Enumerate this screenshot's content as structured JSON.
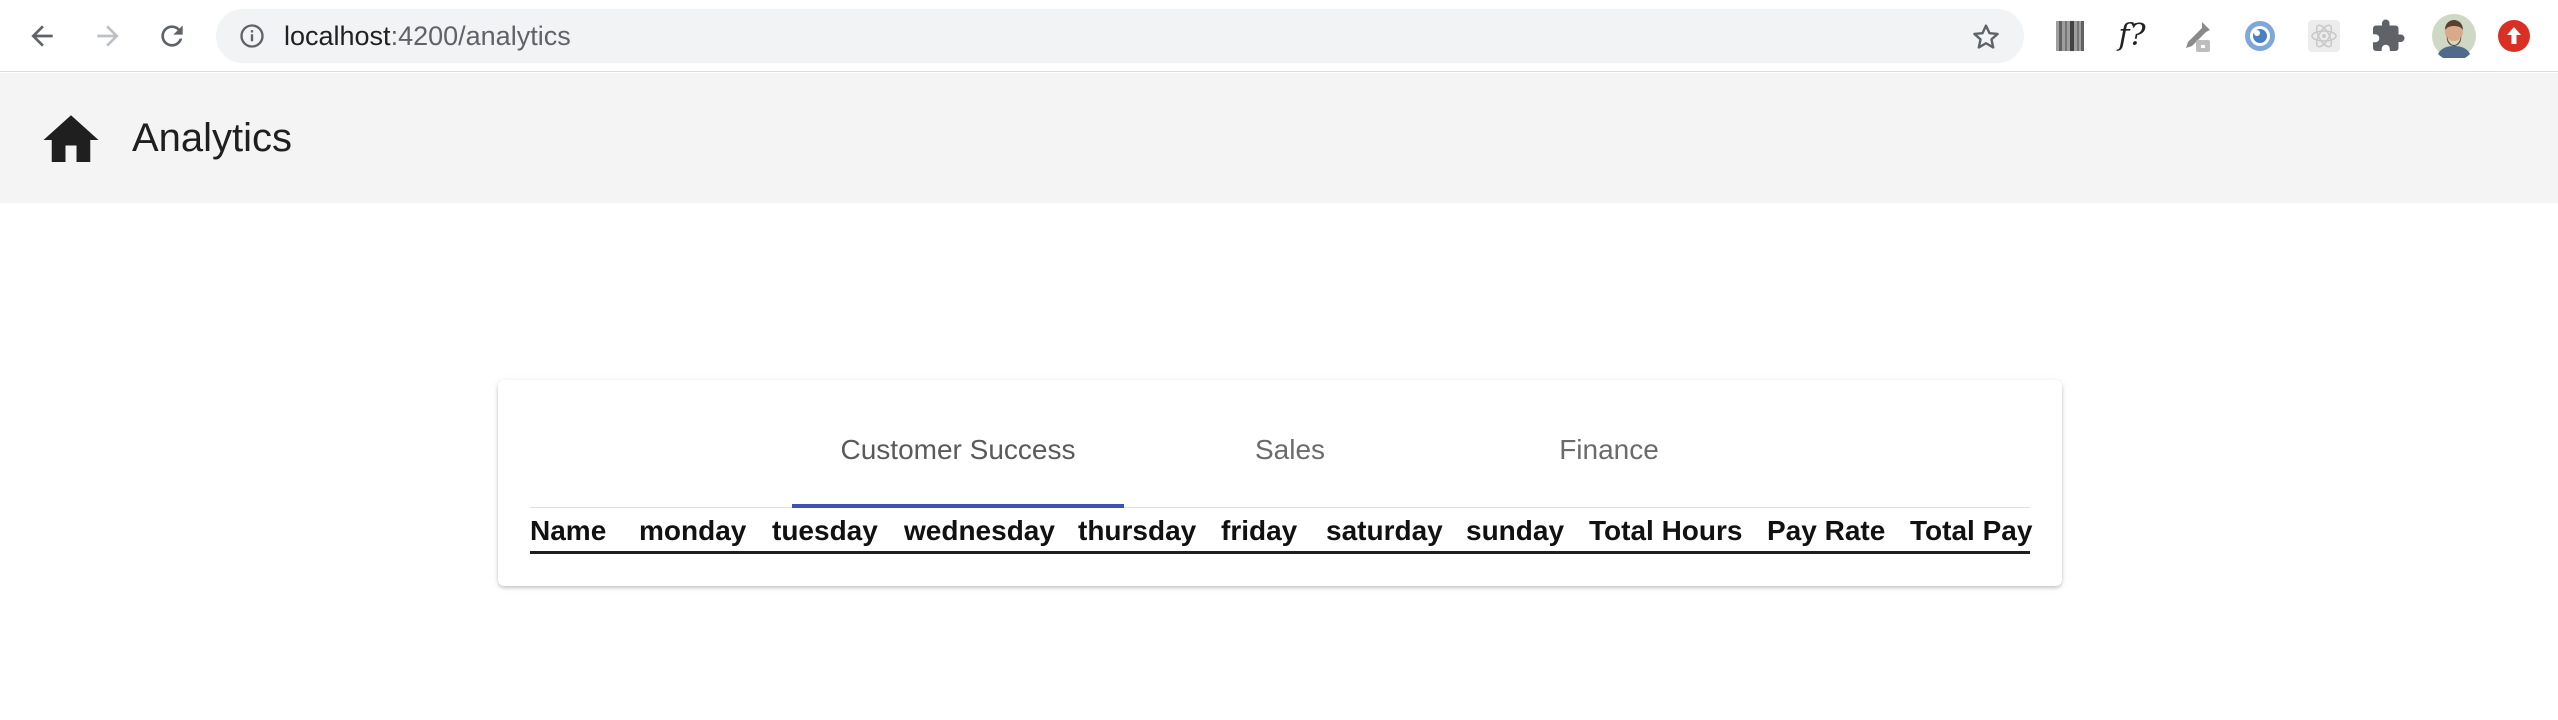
{
  "browser": {
    "url_host": "localhost",
    "url_path": ":4200/analytics",
    "fx_label": "f?"
  },
  "app": {
    "title": "Analytics"
  },
  "tabs": [
    {
      "label": "Customer Success",
      "active": true
    },
    {
      "label": "Sales",
      "active": false
    },
    {
      "label": "Finance",
      "active": false
    }
  ],
  "table": {
    "columns": [
      "Name",
      "monday",
      "tuesday",
      "wednesday",
      "thursday",
      "friday",
      "saturday",
      "sunday",
      "Total Hours",
      "Pay Rate",
      "Total Pay"
    ]
  },
  "colors": {
    "tab_ink": "#3f51b5",
    "toolbar_bg": "#f4f4f4",
    "profile_badge": "#d93025"
  },
  "icons": [
    "back-arrow-icon",
    "forward-arrow-icon",
    "reload-icon",
    "info-icon",
    "star-icon",
    "extension-barcode-icon",
    "extension-fx-icon",
    "extension-eyedropper-icon",
    "extension-circle-icon",
    "extension-react-icon",
    "puzzle-icon",
    "avatar",
    "update-icon",
    "home-icon"
  ]
}
